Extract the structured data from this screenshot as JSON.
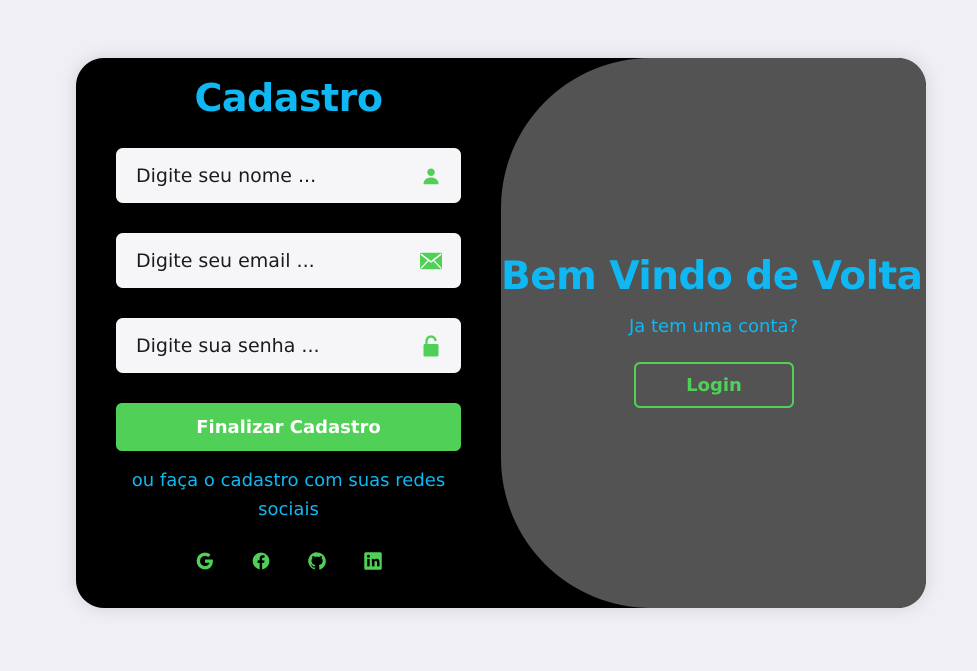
{
  "signup": {
    "title": "Cadastro",
    "fields": [
      {
        "placeholder": "Digite seu nome ...",
        "icon": "user-icon"
      },
      {
        "placeholder": "Digite seu email ...",
        "icon": "envelope-icon"
      },
      {
        "placeholder": "Digite sua senha ...",
        "icon": "lock-icon"
      }
    ],
    "submit_label": "Finalizar Cadastro",
    "social_text": "ou faça o cadastro com suas redes sociais",
    "social_icons": [
      "google-icon",
      "facebook-icon",
      "github-icon",
      "linkedin-icon"
    ]
  },
  "welcome": {
    "title": "Bem Vindo de Volta!",
    "subtitle": "Ja tem uma conta?",
    "login_label": "Login"
  },
  "colors": {
    "accent_blue": "#0fb8f2",
    "accent_green": "#51d057",
    "panel_gray": "#535353",
    "card_black": "#000000",
    "page_bg": "#efeff5"
  }
}
